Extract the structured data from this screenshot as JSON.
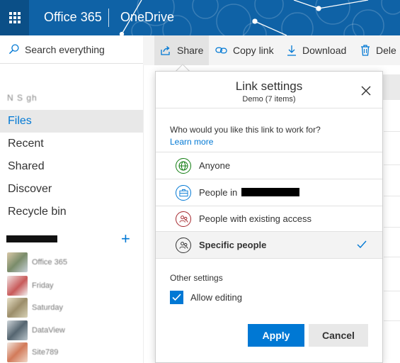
{
  "header": {
    "brand": "Office 365",
    "app_name": "OneDrive",
    "bg_color": "#0f62a6"
  },
  "search": {
    "placeholder": "Search everything"
  },
  "commands": [
    {
      "label": "Share",
      "icon": "share-icon"
    },
    {
      "label": "Copy link",
      "icon": "link-icon"
    },
    {
      "label": "Download",
      "icon": "download-icon"
    },
    {
      "label": "Dele",
      "icon": "trash-icon"
    }
  ],
  "nav": {
    "user": "N   S  gh",
    "items": [
      "Files",
      "Recent",
      "Shared",
      "Discover",
      "Recycle bin"
    ],
    "active": "Files",
    "sites": [
      {
        "label": "Office 365"
      },
      {
        "label": "Friday"
      },
      {
        "label": "Saturday"
      },
      {
        "label": "DataView"
      },
      {
        "label": "Site789"
      }
    ]
  },
  "panel": {
    "title": "Link settings",
    "subtitle": "Demo (7 items)",
    "question": "Who would you like this link to work for?",
    "learn_more": "Learn more",
    "options": [
      {
        "label": "Anyone",
        "icon": "globe-icon",
        "color": "#107c10"
      },
      {
        "label": "People in",
        "icon": "briefcase-icon",
        "color": "#0078d4"
      },
      {
        "label": "People with existing access",
        "icon": "people-icon",
        "color": "#a4262c"
      },
      {
        "label": "Specific people",
        "icon": "people-icon",
        "color": "#333333",
        "selected": true
      }
    ],
    "other_settings": "Other settings",
    "allow_editing": "Allow editing",
    "apply": "Apply",
    "cancel": "Cancel",
    "accent": "#0078d4"
  }
}
